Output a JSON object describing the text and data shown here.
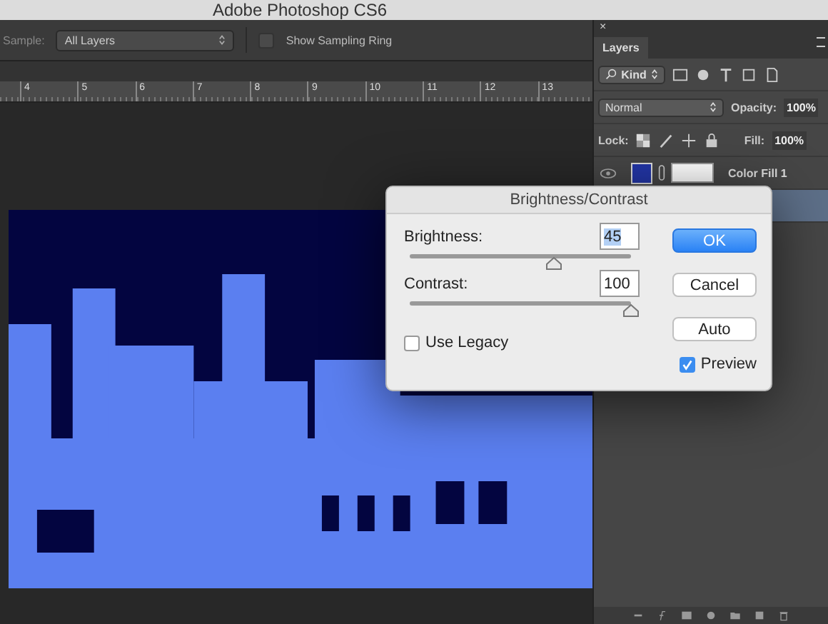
{
  "window": {
    "title": "Adobe Photoshop CS6"
  },
  "options_bar": {
    "sample_label": "Sample:",
    "sample_value": "All Layers",
    "sampling_ring": {
      "label": "Show Sampling Ring",
      "checked": false
    }
  },
  "ruler": [
    "4",
    "5",
    "6",
    "7",
    "8",
    "9",
    "10",
    "11",
    "12",
    "13"
  ],
  "layers_panel": {
    "close": "×",
    "tab": "Layers",
    "filter": "Kind",
    "blend_mode": "Normal",
    "opacity_label": "Opacity:",
    "opacity": "100%",
    "lock_label": "Lock:",
    "fill_label": "Fill:",
    "fill": "100%",
    "layers": [
      {
        "name": "Color Fill 1",
        "kind": "fill",
        "selected": false
      },
      {
        "kind": "image",
        "selected": true
      }
    ]
  },
  "dialog": {
    "title": "Brightness/Contrast",
    "sliders": [
      {
        "label": "Brightness:",
        "value": "45",
        "highlighted": true,
        "level": 0.65
      },
      {
        "label": "Contrast:",
        "value": "100",
        "highlighted": false,
        "level": 1
      }
    ],
    "buttons": [
      {
        "label": "OK",
        "kind": "default"
      },
      {
        "label": "Cancel",
        "kind": "normal"
      },
      {
        "label": "Auto",
        "kind": "normal"
      }
    ],
    "use_legacy": {
      "label": "Use Legacy",
      "checked": false
    },
    "preview": {
      "label": "Preview",
      "checked": true
    }
  }
}
